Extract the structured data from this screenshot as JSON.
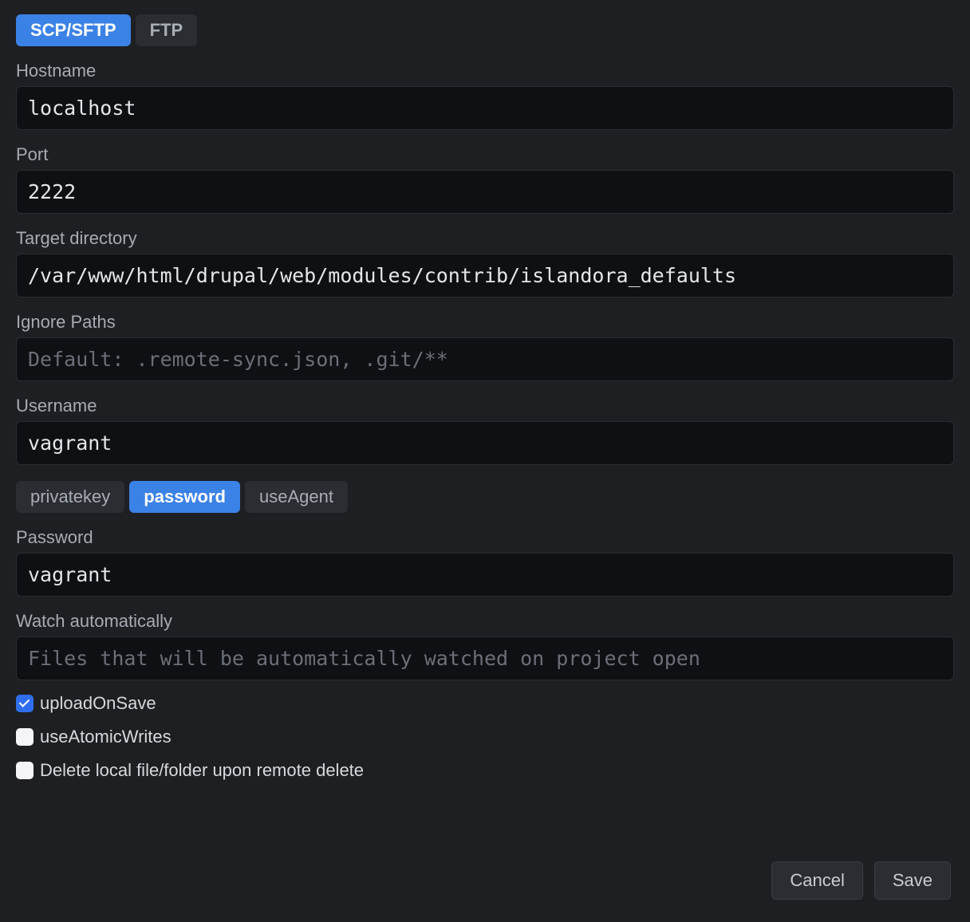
{
  "protocol_tabs": {
    "scp_sftp": "SCP/SFTP",
    "ftp": "FTP",
    "active": "scp_sftp"
  },
  "fields": {
    "hostname": {
      "label": "Hostname",
      "value": "localhost"
    },
    "port": {
      "label": "Port",
      "value": "2222"
    },
    "target_directory": {
      "label": "Target directory",
      "value": "/var/www/html/drupal/web/modules/contrib/islandora_defaults"
    },
    "ignore_paths": {
      "label": "Ignore Paths",
      "value": "",
      "placeholder": "Default: .remote-sync.json, .git/**"
    },
    "username": {
      "label": "Username",
      "value": "vagrant"
    },
    "password": {
      "label": "Password",
      "value": "vagrant"
    },
    "watch_automatically": {
      "label": "Watch automatically",
      "value": "",
      "placeholder": "Files that will be automatically watched on project open"
    }
  },
  "auth_tabs": {
    "privatekey": "privatekey",
    "password": "password",
    "useAgent": "useAgent",
    "active": "password"
  },
  "checkboxes": {
    "upload_on_save": {
      "label": "uploadOnSave",
      "checked": true
    },
    "use_atomic_writes": {
      "label": "useAtomicWrites",
      "checked": false
    },
    "delete_local_on_remote_delete": {
      "label": "Delete local file/folder upon remote delete",
      "checked": false
    }
  },
  "buttons": {
    "cancel": "Cancel",
    "save": "Save"
  }
}
